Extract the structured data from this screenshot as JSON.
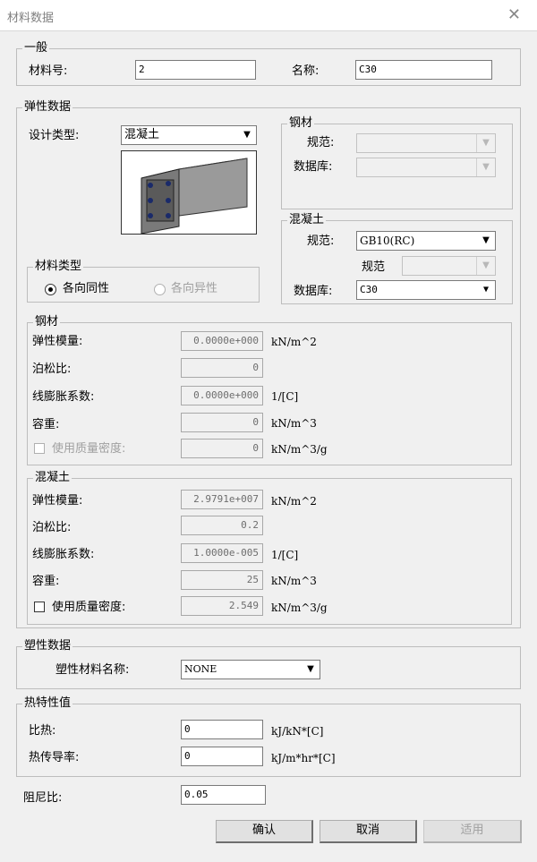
{
  "window": {
    "title": "材料数据"
  },
  "general": {
    "legend": "一般",
    "id_label": "材料号:",
    "id_value": "2",
    "name_label": "名称:",
    "name_value": "C30"
  },
  "elastic": {
    "legend": "弹性数据",
    "design_type_label": "设计类型:",
    "design_type_value": "混凝土",
    "steel_group": {
      "legend": "钢材",
      "code_label": "规范:",
      "db_label": "数据库:"
    },
    "concrete_group": {
      "legend": "混凝土",
      "code_label": "规范:",
      "code_value": "GB10(RC)",
      "code2_label": "规范",
      "db_label": "数据库:",
      "db_value": "C30"
    },
    "material_type": {
      "legend": "材料类型",
      "isotropic": "各向同性",
      "anisotropic": "各向异性",
      "selected": "各向同性"
    }
  },
  "steel": {
    "legend": "钢材",
    "rows": [
      {
        "label": "弹性模量:",
        "value": "0.0000e+000",
        "unit": "kN/m^2"
      },
      {
        "label": "泊松比:",
        "value": "0",
        "unit": ""
      },
      {
        "label": "线膨胀系数:",
        "value": "0.0000e+000",
        "unit": "1/[C]"
      },
      {
        "label": "容重:",
        "value": "0",
        "unit": "kN/m^3"
      },
      {
        "label": "使用质量密度:",
        "value": "0",
        "unit": "kN/m^3/g"
      }
    ]
  },
  "concrete": {
    "legend": "混凝土",
    "rows": [
      {
        "label": "弹性模量:",
        "value": "2.9791e+007",
        "unit": "kN/m^2"
      },
      {
        "label": "泊松比:",
        "value": "0.2",
        "unit": ""
      },
      {
        "label": "线膨胀系数:",
        "value": "1.0000e-005",
        "unit": "1/[C]"
      },
      {
        "label": "容重:",
        "value": "25",
        "unit": "kN/m^3"
      },
      {
        "label": "使用质量密度:",
        "value": "2.549",
        "unit": "kN/m^3/g"
      }
    ]
  },
  "plastic": {
    "legend": "塑性数据",
    "name_label": "塑性材料名称:",
    "name_value": "NONE"
  },
  "thermal": {
    "legend": "热特性值",
    "specific_heat_label": "比热:",
    "specific_heat_value": "0",
    "specific_heat_unit": "kJ/kN*[C]",
    "conductivity_label": "热传导率:",
    "conductivity_value": "0",
    "conductivity_unit": "kJ/m*hr*[C]"
  },
  "damping": {
    "label": "阻尼比:",
    "value": "0.05"
  },
  "buttons": {
    "ok": "确认",
    "cancel": "取消",
    "apply": "适用"
  }
}
